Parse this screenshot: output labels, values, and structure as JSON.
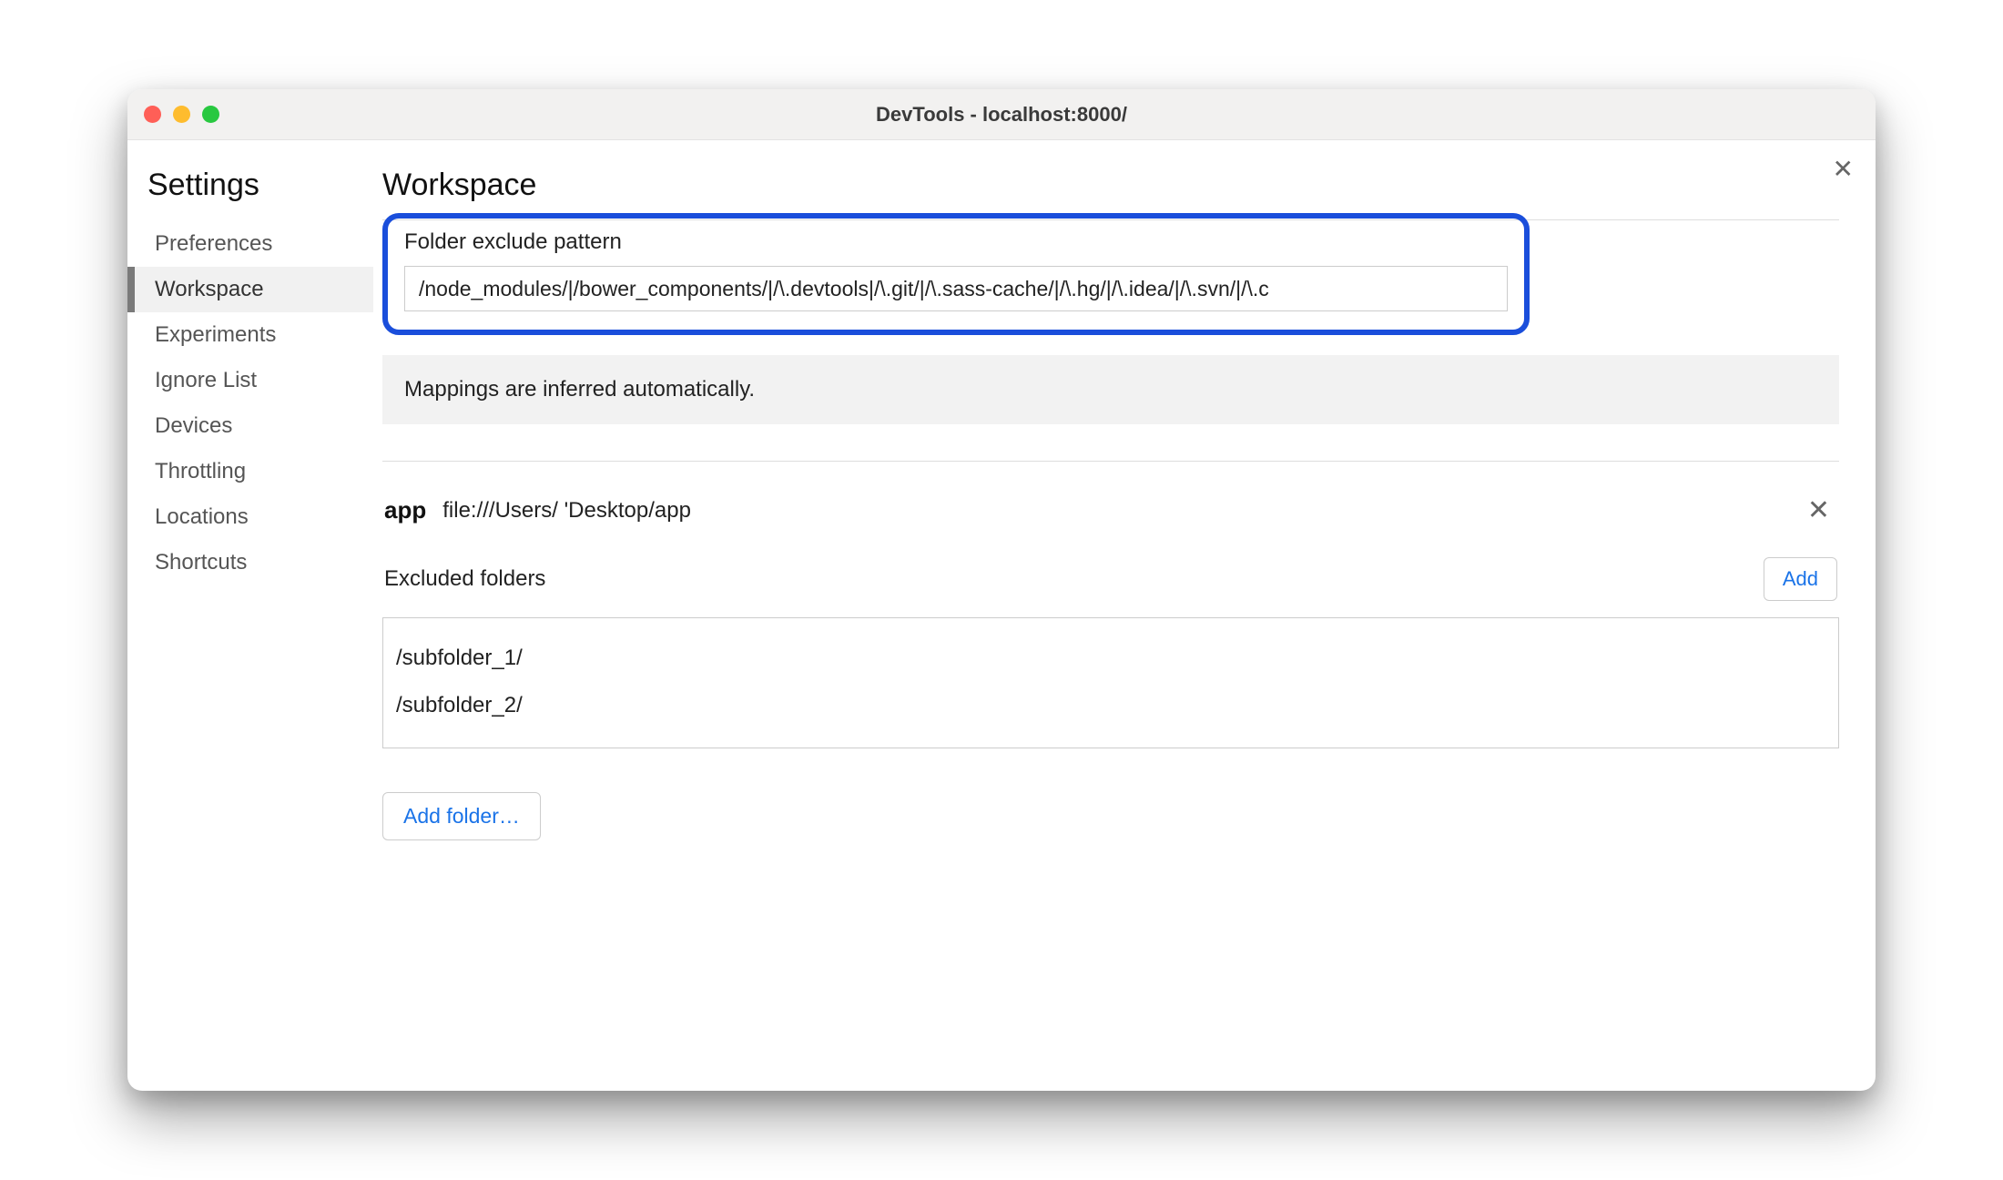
{
  "window": {
    "title": "DevTools - localhost:8000/"
  },
  "sidebar": {
    "title": "Settings",
    "items": [
      {
        "label": "Preferences",
        "active": false
      },
      {
        "label": "Workspace",
        "active": true
      },
      {
        "label": "Experiments",
        "active": false
      },
      {
        "label": "Ignore List",
        "active": false
      },
      {
        "label": "Devices",
        "active": false
      },
      {
        "label": "Throttling",
        "active": false
      },
      {
        "label": "Locations",
        "active": false
      },
      {
        "label": "Shortcuts",
        "active": false
      }
    ]
  },
  "main": {
    "title": "Workspace",
    "exclude_pattern": {
      "label": "Folder exclude pattern",
      "value": "/node_modules/|/bower_components/|/\\.devtools|/\\.git/|/\\.sass-cache/|/\\.hg/|/\\.idea/|/\\.svn/|/\\.c"
    },
    "info": "Mappings are inferred automatically.",
    "folder": {
      "name": "app",
      "path": "file:///Users/         'Desktop/app"
    },
    "excluded": {
      "label": "Excluded folders",
      "add_label": "Add",
      "items": [
        "/subfolder_1/",
        "/subfolder_2/"
      ]
    },
    "add_folder_label": "Add folder…"
  }
}
